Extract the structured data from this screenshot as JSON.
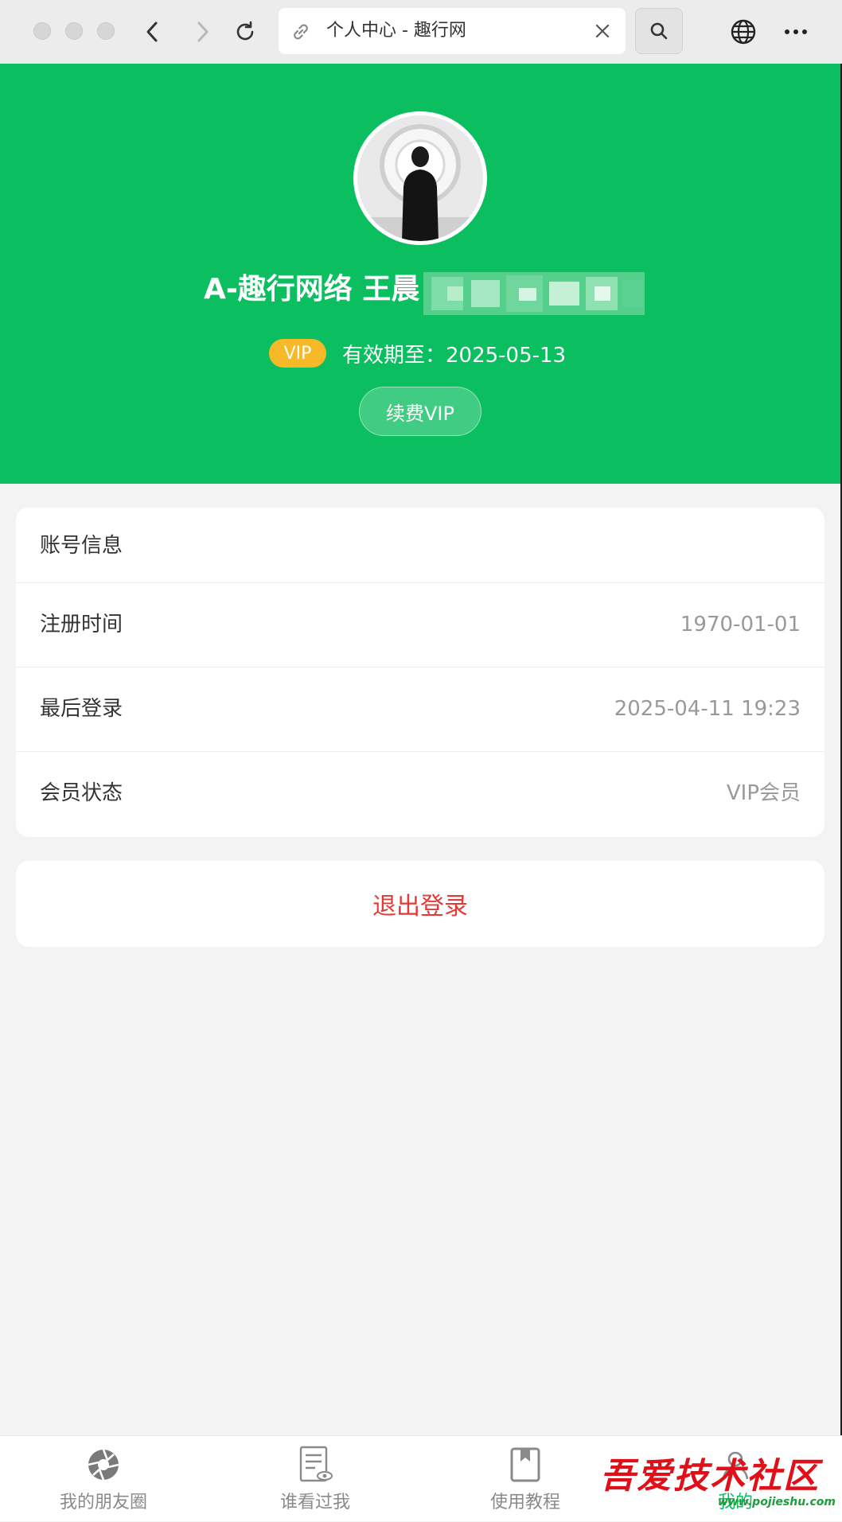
{
  "browser": {
    "tab_title": "个人中心 - 趣行网",
    "icons": {
      "back": "chevron-left-icon",
      "forward": "chevron-right-icon",
      "reload": "reload-icon",
      "link": "link-icon",
      "close": "close-icon",
      "search": "search-icon",
      "globe": "globe-icon",
      "more": "more-icon"
    }
  },
  "profile": {
    "name": "A-趣行网络 王晨",
    "vip_badge": "VIP",
    "expire_text": "有效期至：2025-05-13",
    "renew_label": "续费VIP",
    "header_color": "#0bbe5f"
  },
  "account": {
    "title": "账号信息",
    "rows": [
      {
        "label": "注册时间",
        "value": "1970-01-01"
      },
      {
        "label": "最后登录",
        "value": "2025-04-11 19:23"
      },
      {
        "label": "会员状态",
        "value": "VIP会员"
      }
    ]
  },
  "logout_label": "退出登录",
  "bottom_nav": [
    {
      "label": "我的朋友圈",
      "icon": "aperture-icon"
    },
    {
      "label": "谁看过我",
      "icon": "document-eye-icon"
    },
    {
      "label": "使用教程",
      "icon": "bookmark-book-icon"
    },
    {
      "label": "我的",
      "icon": "user-icon",
      "active": true
    }
  ],
  "watermark": {
    "main": "吾爱技术社区",
    "sub": "www.pojieshu.com"
  },
  "colors": {
    "accent": "#0bbe5f",
    "vip": "#f7b928",
    "danger": "#e53935"
  }
}
